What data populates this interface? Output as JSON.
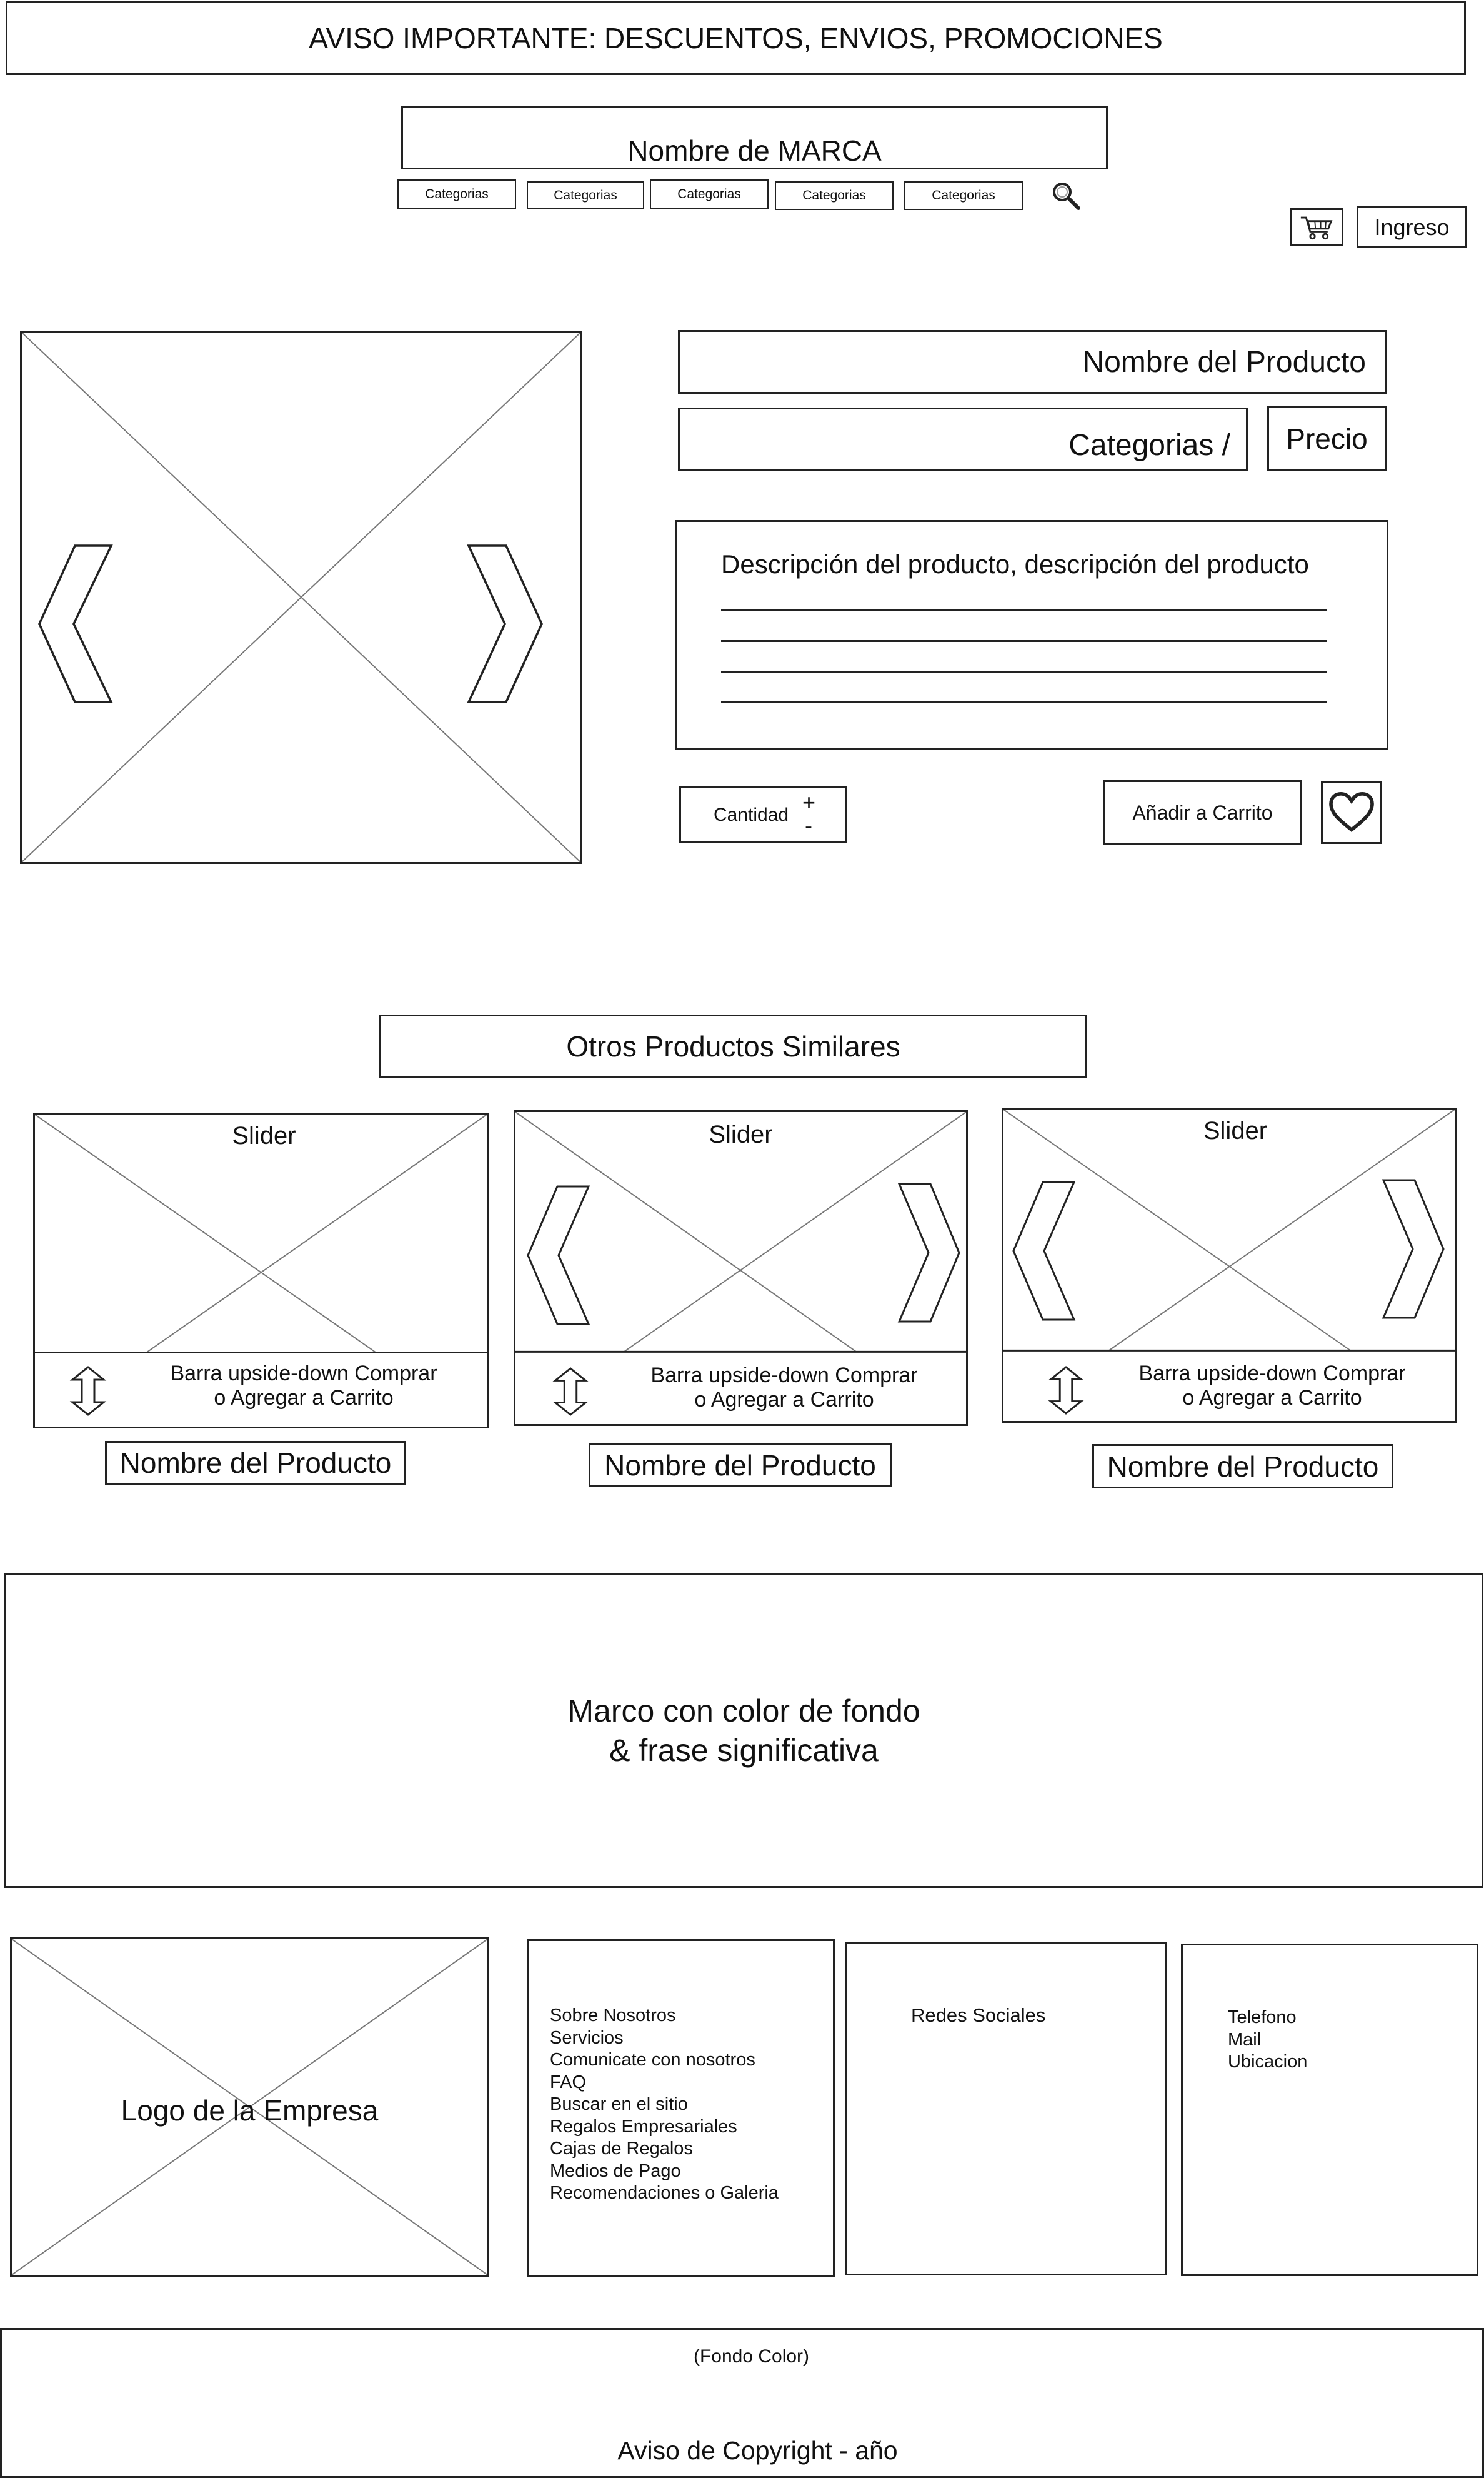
{
  "announcement": "AVISO IMPORTANTE: DESCUENTOS, ENVIOS, PROMOCIONES",
  "brand": "Nombre de MARCA",
  "nav": {
    "categories": [
      "Categorias",
      "Categorias",
      "Categorias",
      "Categorias",
      "Categorias"
    ],
    "search_icon": "search-icon",
    "cart_icon": "cart-icon",
    "login": "Ingreso"
  },
  "product": {
    "name": "Nombre del Producto",
    "categories": "Categorias /",
    "price": "Precio",
    "description": "Descripción del producto, descripción del producto",
    "quantity_label": "Cantidad",
    "plus": "+",
    "minus": "-",
    "add_to_cart": "Añadir a Carrito",
    "favorite_icon": "heart-icon"
  },
  "similar": {
    "title": "Otros Productos Similares",
    "cards": [
      {
        "slider": "Slider",
        "bar": [
          "Barra upside-down Comprar",
          "o Agregar a Carrito"
        ],
        "name": "Nombre del Producto"
      },
      {
        "slider": "Slider",
        "bar": [
          "Barra upside-down Comprar",
          "o Agregar a Carrito"
        ],
        "name": "Nombre del Producto"
      },
      {
        "slider": "Slider",
        "bar": [
          "Barra upside-down Comprar",
          "o Agregar a Carrito"
        ],
        "name": "Nombre del Producto"
      }
    ]
  },
  "banner": [
    "Marco con color de fondo",
    "&  frase significativa"
  ],
  "footer": {
    "logo": "Logo de la Empresa",
    "links": [
      "Sobre Nosotros",
      "Servicios",
      "Comunicate con nosotros",
      "FAQ",
      "Buscar en el sitio",
      "Regalos Empresariales",
      "Cajas de Regalos",
      "Medios de Pago",
      "Recomendaciones o Galeria"
    ],
    "social": "Redes Sociales",
    "contact": [
      "Telefono",
      "Mail",
      "Ubicacion"
    ]
  },
  "bottom": {
    "note": "(Fondo Color)",
    "copyright": "Aviso de Copyright - año"
  }
}
